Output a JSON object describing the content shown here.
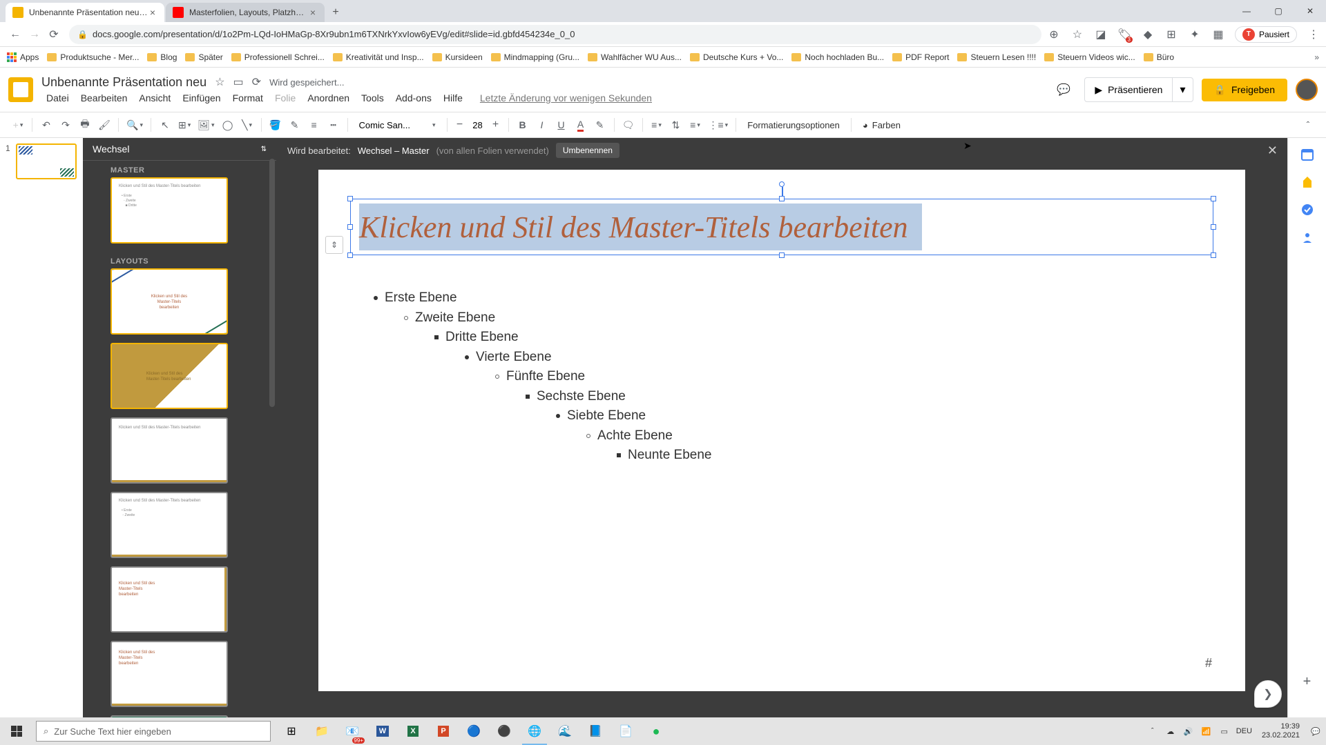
{
  "chrome": {
    "tabs": [
      {
        "title": "Unbenannte Präsentation neu - G",
        "active": true
      },
      {
        "title": "Masterfolien, Layouts, Platzhalte",
        "active": false
      }
    ],
    "url": "docs.google.com/presentation/d/1o2Pm-LQd-IoHMaGp-8Xr9ubn1m6TXNrkYxvIow6yEVg/edit#slide=id.gbfd454234e_0_0",
    "profile_status": "Pausiert",
    "profile_initial": "T"
  },
  "bookmarks": [
    "Apps",
    "Produktsuche - Mer...",
    "Blog",
    "Später",
    "Professionell Schrei...",
    "Kreativität und Insp...",
    "Kursideen",
    "Mindmapping  (Gru...",
    "Wahlfächer WU Aus...",
    "Deutsche Kurs + Vo...",
    "Noch hochladen Bu...",
    "PDF Report",
    "Steuern Lesen !!!!",
    "Steuern Videos wic...",
    "Büro"
  ],
  "doc": {
    "title": "Unbenannte Präsentation neu",
    "saving": "Wird gespeichert...",
    "last_change": "Letzte Änderung vor wenigen Sekunden"
  },
  "menubar": [
    "Datei",
    "Bearbeiten",
    "Ansicht",
    "Einfügen",
    "Format",
    "Folie",
    "Anordnen",
    "Tools",
    "Add-ons",
    "Hilfe"
  ],
  "header_buttons": {
    "present": "Präsentieren",
    "share": "Freigeben"
  },
  "toolbar": {
    "font": "Comic San...",
    "font_size": "28",
    "format_options": "Formatierungsoptionen",
    "colors": "Farben"
  },
  "master_panel": {
    "theme": "Wechsel",
    "section_master": "MASTER",
    "section_layouts": "LAYOUTS"
  },
  "editor_bar": {
    "prefix": "Wird bearbeitet:",
    "title": "Wechsel – Master",
    "sub": "(von allen Folien verwendet)",
    "rename": "Umbenennen"
  },
  "slide": {
    "title_placeholder": "Klicken und Stil des Master-Titels bearbeiten",
    "levels": [
      "Erste Ebene",
      "Zweite Ebene",
      "Dritte Ebene",
      "Vierte Ebene",
      "Fünfte Ebene",
      "Sechste Ebene",
      "Siebte Ebene",
      "Achte Ebene",
      "Neunte Ebene"
    ],
    "slide_number": "#"
  },
  "taskbar": {
    "search_placeholder": "Zur Suche Text hier eingeben",
    "notif_count": "99+",
    "lang": "DEU",
    "time": "19:39",
    "date": "23.02.2021"
  }
}
